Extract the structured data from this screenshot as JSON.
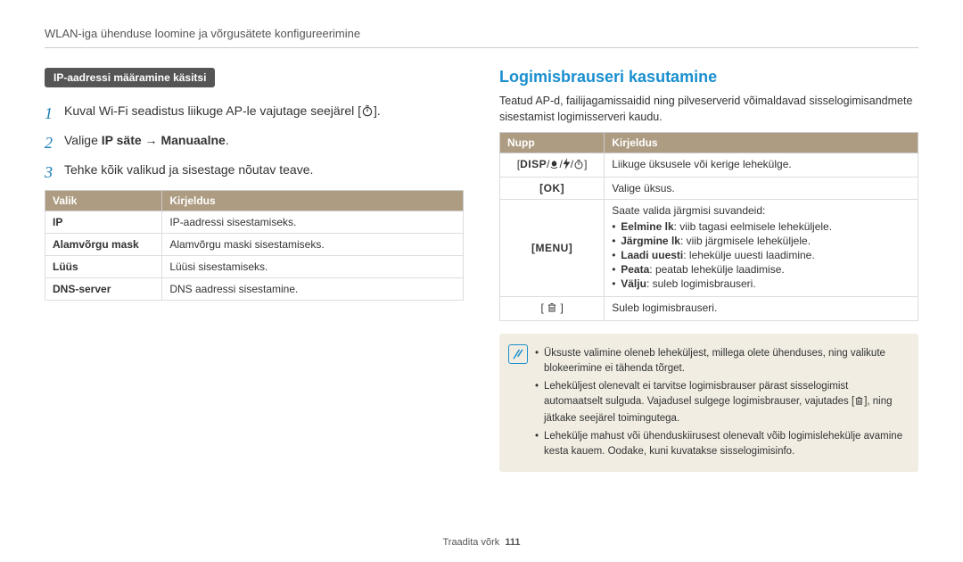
{
  "header": "WLAN-iga ühenduse loomine ja võrgusätete konfigureerimine",
  "left": {
    "pill": "IP-aadressi määramine käsitsi",
    "step1_pre": "Kuval Wi-Fi seadistus liikuge AP-le vajutage seejärel [",
    "step1_post": "].",
    "step2_pre": "Valige ",
    "step2_bold1": "IP säte",
    "step2_mid": " → ",
    "step2_bold2": "Manuaalne",
    "step2_post": ".",
    "step3": "Tehke kõik valikud ja sisestage nõutav teave.",
    "th_valik": "Valik",
    "th_kirj": "Kirjeldus",
    "rows": [
      {
        "a": "IP",
        "b": "IP-aadressi sisestamiseks."
      },
      {
        "a": "Alamvõrgu mask",
        "b": "Alamvõrgu maski sisestamiseks."
      },
      {
        "a": "Lüüs",
        "b": "Lüüsi sisestamiseks."
      },
      {
        "a": "DNS-server",
        "b": "DNS aadressi sisestamine."
      }
    ]
  },
  "right": {
    "title": "Logimisbrauseri kasutamine",
    "intro": "Teatud AP-d, failijagamissaidid ning pilveserverid võimaldavad sisselogimisandmete sisestamist logimisserveri kaudu.",
    "th_nupp": "Nupp",
    "th_kirj": "Kirjeldus",
    "row1_btn_pre": "[",
    "row1_btn_disp": "DISP",
    "row1_btn_post": "]",
    "row1_desc": "Liikuge üksusele või kerige lehekülge.",
    "row2_btn": "[OK]",
    "row2_desc": "Valige üksus.",
    "row3_btn": "[MENU]",
    "row3_intro": "Saate valida järgmisi suvandeid:",
    "row3_items": {
      "a_b": "Eelmine lk",
      "a_t": ": viib tagasi eelmisele leheküljele.",
      "b_b": "Järgmine lk",
      "b_t": ": viib järgmisele leheküljele.",
      "c_b": "Laadi uuesti",
      "c_t": ": lehekülje uuesti laadimine.",
      "d_b": "Peata",
      "d_t": ": peatab lehekülje laadimise.",
      "e_b": "Välju",
      "e_t": ": suleb logimisbrauseri."
    },
    "row4_desc": "Suleb logimisbrauseri.",
    "notes": {
      "n1": "Üksuste valimine oleneb leheküljest, millega olete ühenduses, ning valikute blokeerimine ei tähenda tõrget.",
      "n2a": "Leheküljest olenevalt ei tarvitse logimisbrauser pärast sisselogimist automaatselt sulguda. Vajadusel sulgege logimisbrauser, vajutades [",
      "n2b": "], ning jätkake seejärel toimingutega.",
      "n3": "Lehekülje mahust või ühenduskiirusest olenevalt võib logimislehekülje avamine kesta kauem. Oodake, kuni kuvatakse sisselogimisinfo."
    }
  },
  "footer": {
    "section": "Traadita võrk",
    "page": "111"
  }
}
